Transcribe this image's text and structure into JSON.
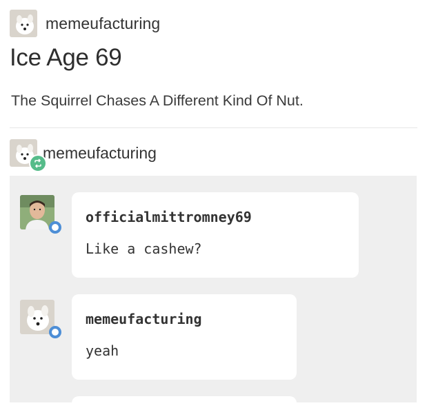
{
  "post": {
    "author": "memeufacturing",
    "title": "Ice Age 69",
    "body": "The Squirrel Chases A Different Kind Of Nut."
  },
  "reblog": {
    "author": "memeufacturing",
    "badge_icon": "reblog-icon"
  },
  "chat": [
    {
      "username": "officialmittromney69",
      "message": "Like a cashew?",
      "avatar": "person-avatar"
    },
    {
      "username": "memeufacturing",
      "message": "yeah",
      "avatar": "dog-avatar"
    }
  ],
  "colors": {
    "reblog_badge": "#56bc8a",
    "online_ring": "#4d8ed6",
    "chat_background": "#efefef"
  }
}
